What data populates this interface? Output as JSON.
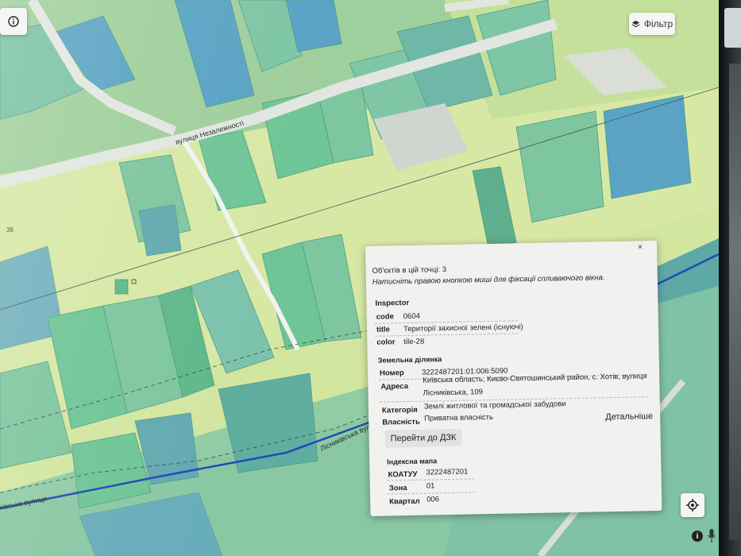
{
  "map": {
    "street_labels": [
      "вулиця Незалежності",
      "Лісниківська вулиця",
      "ківська вулиця"
    ],
    "parcel_number": "38",
    "filter_label": "Фільтр",
    "colors": {
      "base": "#9fcf9c",
      "parcel": "#7fc8a0",
      "parcel_dark": "#5fae8d",
      "teal": "#63b2b4",
      "blue": "#5fa7c9",
      "road": "#d9dfd6",
      "zone": "#d7e8a5",
      "line": "#1f45b8"
    }
  },
  "icons": {
    "info": "info-icon",
    "filter": "layers-icon",
    "locate": "target-icon",
    "close": "close-icon",
    "mic": "microphone-icon",
    "cursor": "hand-cursor-icon"
  },
  "popup": {
    "close": "×",
    "count": "Об'єктів в цій точці: 3",
    "hint": "Натисніть правою кнопкою миші для фіксації спливаючого вікна.",
    "inspector": {
      "title": "Inspector",
      "rows": [
        {
          "key": "code",
          "value": "0604"
        },
        {
          "key": "title",
          "value": "Території захисної зелені (існуючі)"
        },
        {
          "key": "color",
          "value": "tile-28"
        }
      ]
    },
    "parcel": {
      "title": "Земельна ділянка",
      "number_key": "Номер",
      "number": "3222487201:01:006:5090",
      "address_key": "Адреса",
      "address_line1": "Київська область, Києво-Святошинський район, с. Хотів, вулиця",
      "address_line2": "Лісниківська, 109",
      "category_key": "Категорія",
      "category": "Землі житлової та громадської забудови",
      "ownership_key": "Власність",
      "ownership": "Приватна власність",
      "details_btn": "Детальніше",
      "dzk_btn": "Перейти до ДЗК"
    },
    "index_map": {
      "title": "Індексна мапа",
      "rows": [
        {
          "key": "КОАТУУ",
          "value": "3222487201"
        },
        {
          "key": "Зона",
          "value": "01"
        },
        {
          "key": "Квартал",
          "value": "006"
        }
      ]
    }
  }
}
